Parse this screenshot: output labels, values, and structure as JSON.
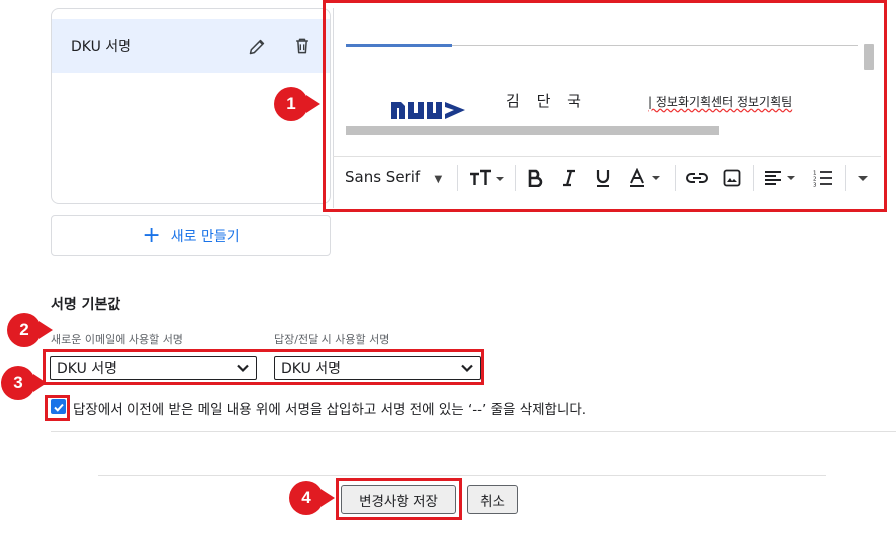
{
  "signatures": {
    "items": [
      {
        "label": "DKU 서명"
      }
    ],
    "new_button_label": "새로 만들기"
  },
  "editor": {
    "name": "김 단 국",
    "dept": "| 정보화기획센터 정보기획팀",
    "toolbar": {
      "font": "Sans Serif"
    }
  },
  "defaults": {
    "title": "서명 기본값",
    "new_mail_label": "새로운 이메일에 사용할 서명",
    "reply_label": "답장/전달 시 사용할 서명",
    "new_mail_value": "DKU 서명",
    "reply_value": "DKU 서명",
    "insert_before_quote_label": "답장에서 이전에 받은 메일 내용 위에 서명을 삽입하고 서명 전에 있는 ‘--’ 줄을 삭제합니다."
  },
  "actions": {
    "save_label": "변경사항 저장",
    "cancel_label": "취소"
  },
  "callouts": [
    "1",
    "2",
    "3",
    "4"
  ],
  "colors": {
    "accent": "#1a73e8",
    "highlight_red": "#e11b22",
    "selected_bg": "#e8f0fe"
  }
}
